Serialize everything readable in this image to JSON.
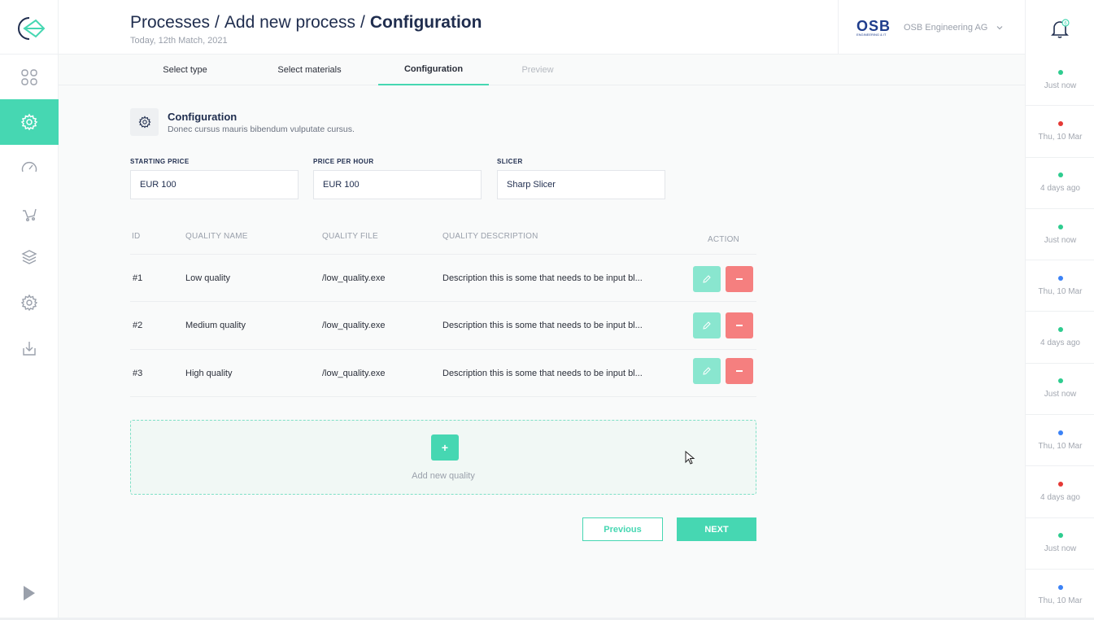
{
  "header": {
    "breadcrumb": [
      "Processes",
      "Add new process",
      "Configuration"
    ],
    "separator": "/",
    "date": "Today, 12th Match, 2021",
    "company": {
      "logo_text": "OSB",
      "logo_subtext": "ENGINEERING & IT",
      "name": "OSB Engineering AG"
    }
  },
  "sidebar": {
    "items": [
      {
        "icon": "dashboard-icon"
      },
      {
        "icon": "gear-icon",
        "active": true
      },
      {
        "icon": "speedometer-icon"
      },
      {
        "icon": "cart-icon"
      },
      {
        "icon": "layers-icon"
      },
      {
        "icon": "settings-alt-icon"
      },
      {
        "icon": "download-icon"
      }
    ],
    "bottom_icon": "play-icon"
  },
  "tabs": [
    {
      "label": "Select type",
      "state": "done"
    },
    {
      "label": "Select materials",
      "state": "done"
    },
    {
      "label": "Configuration",
      "state": "active"
    },
    {
      "label": "Preview",
      "state": "disabled"
    }
  ],
  "section": {
    "icon": "gear-icon",
    "title": "Configuration",
    "subtitle": "Donec cursus mauris bibendum vulputate cursus."
  },
  "fields": {
    "starting_price": {
      "label": "STARTING PRICE",
      "value": "EUR 100"
    },
    "price_per_hour": {
      "label": "PRICE PER HOUR",
      "value": "EUR 100"
    },
    "slicer": {
      "label": "SLICER",
      "value": "Sharp Slicer"
    }
  },
  "table": {
    "headers": {
      "id": "ID",
      "name": "QUALITY NAME",
      "file": "QUALITY FILE",
      "description": "QUALITY DESCRIPTION",
      "action": "ACTION"
    },
    "rows": [
      {
        "id": "#1",
        "name": "Low quality",
        "file": "/low_quality.exe",
        "description": "Description this is some that needs to be input bl..."
      },
      {
        "id": "#2",
        "name": "Medium quality",
        "file": "/low_quality.exe",
        "description": "Description this is some that needs to be input bl..."
      },
      {
        "id": "#3",
        "name": "High quality",
        "file": "/low_quality.exe",
        "description": "Description this is some that needs to be input bl..."
      }
    ]
  },
  "add_quality": {
    "plus": "+",
    "label": "Add new quality"
  },
  "buttons": {
    "previous": "Previous",
    "next": "NEXT"
  },
  "notifications": {
    "badge": "6",
    "items": [
      {
        "status": "green",
        "time": "Just now"
      },
      {
        "status": "red",
        "time": "Thu, 10 Mar"
      },
      {
        "status": "green",
        "time": "4 days ago"
      },
      {
        "status": "green",
        "time": "Just now"
      },
      {
        "status": "blue",
        "time": "Thu, 10 Mar"
      },
      {
        "status": "green",
        "time": "4 days ago"
      },
      {
        "status": "green",
        "time": "Just now"
      },
      {
        "status": "blue",
        "time": "Thu, 10 Mar"
      },
      {
        "status": "red",
        "time": "4 days ago"
      },
      {
        "status": "green",
        "time": "Just now"
      },
      {
        "status": "blue",
        "time": "Thu, 10 Mar"
      }
    ]
  },
  "colors": {
    "accent": "#46d7b2",
    "danger": "#f57f7f",
    "status_green": "#2ecc8f",
    "status_red": "#e53935",
    "status_blue": "#3b82f6"
  }
}
